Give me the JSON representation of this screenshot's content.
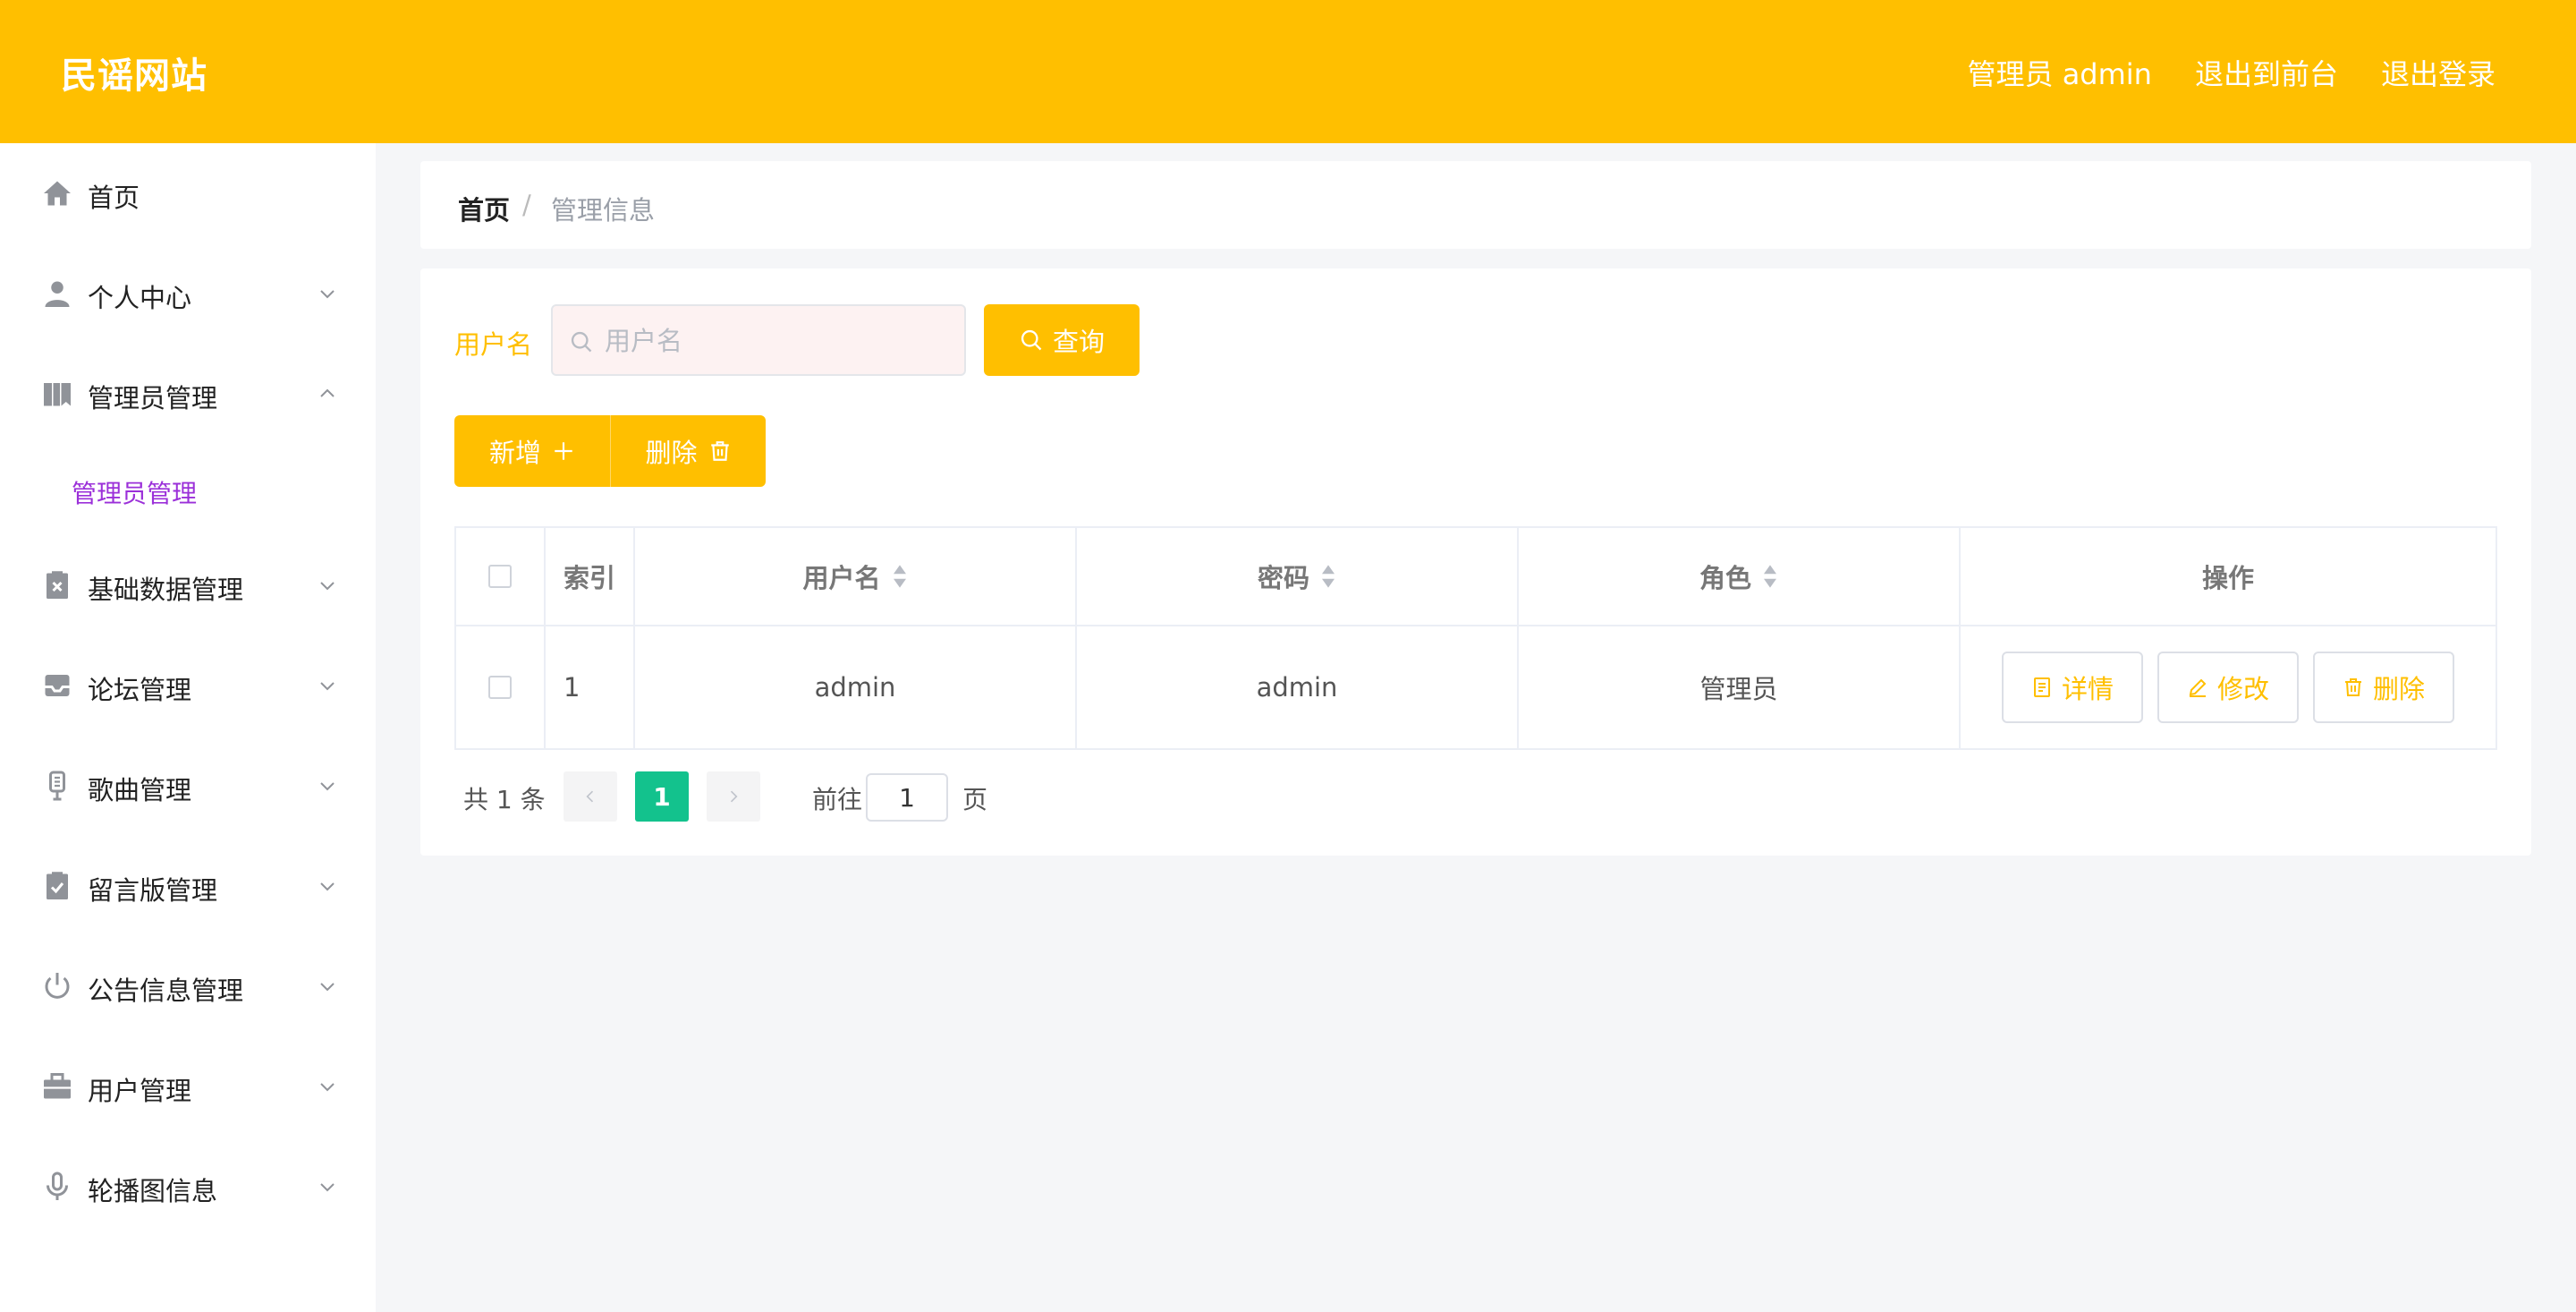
{
  "header": {
    "title": "民谣网站",
    "links": [
      "管理员 admin",
      "退出到前台",
      "退出登录"
    ]
  },
  "sidebar": {
    "items": [
      {
        "label": "首页",
        "icon": "home-icon"
      },
      {
        "label": "个人中心",
        "icon": "user-icon"
      },
      {
        "label": "管理员管理",
        "icon": "book-icon"
      },
      {
        "label": "基础数据管理",
        "icon": "clipboard-x-icon"
      },
      {
        "label": "论坛管理",
        "icon": "inbox-icon"
      },
      {
        "label": "歌曲管理",
        "icon": "microphone-stand-icon"
      },
      {
        "label": "留言版管理",
        "icon": "clipboard-check-icon"
      },
      {
        "label": "公告信息管理",
        "icon": "power-icon"
      },
      {
        "label": "用户管理",
        "icon": "briefcase-icon"
      },
      {
        "label": "轮播图信息",
        "icon": "microphone-icon"
      }
    ],
    "submenu": {
      "label": "管理员管理"
    }
  },
  "breadcrumb": {
    "home": "首页",
    "separator": "/",
    "current": "管理信息"
  },
  "search": {
    "label": "用户名",
    "placeholder": "用户名",
    "button": "查询"
  },
  "actions": {
    "add": "新增",
    "delete": "删除"
  },
  "table": {
    "columns": [
      "索引",
      "用户名",
      "密码",
      "角色",
      "操作"
    ],
    "rows": [
      {
        "index": "1",
        "username": "admin",
        "password": "admin",
        "role": "管理员"
      }
    ],
    "row_actions": {
      "detail": "详情",
      "edit": "修改",
      "delete": "删除"
    }
  },
  "pagination": {
    "total": "共 1 条",
    "current_page": "1",
    "goto": "前往",
    "page_input": "1",
    "page_suffix": "页"
  },
  "colors": {
    "brand": "#ffbf00",
    "active_page": "#13c28d",
    "submenu_active": "#9b30d9"
  }
}
